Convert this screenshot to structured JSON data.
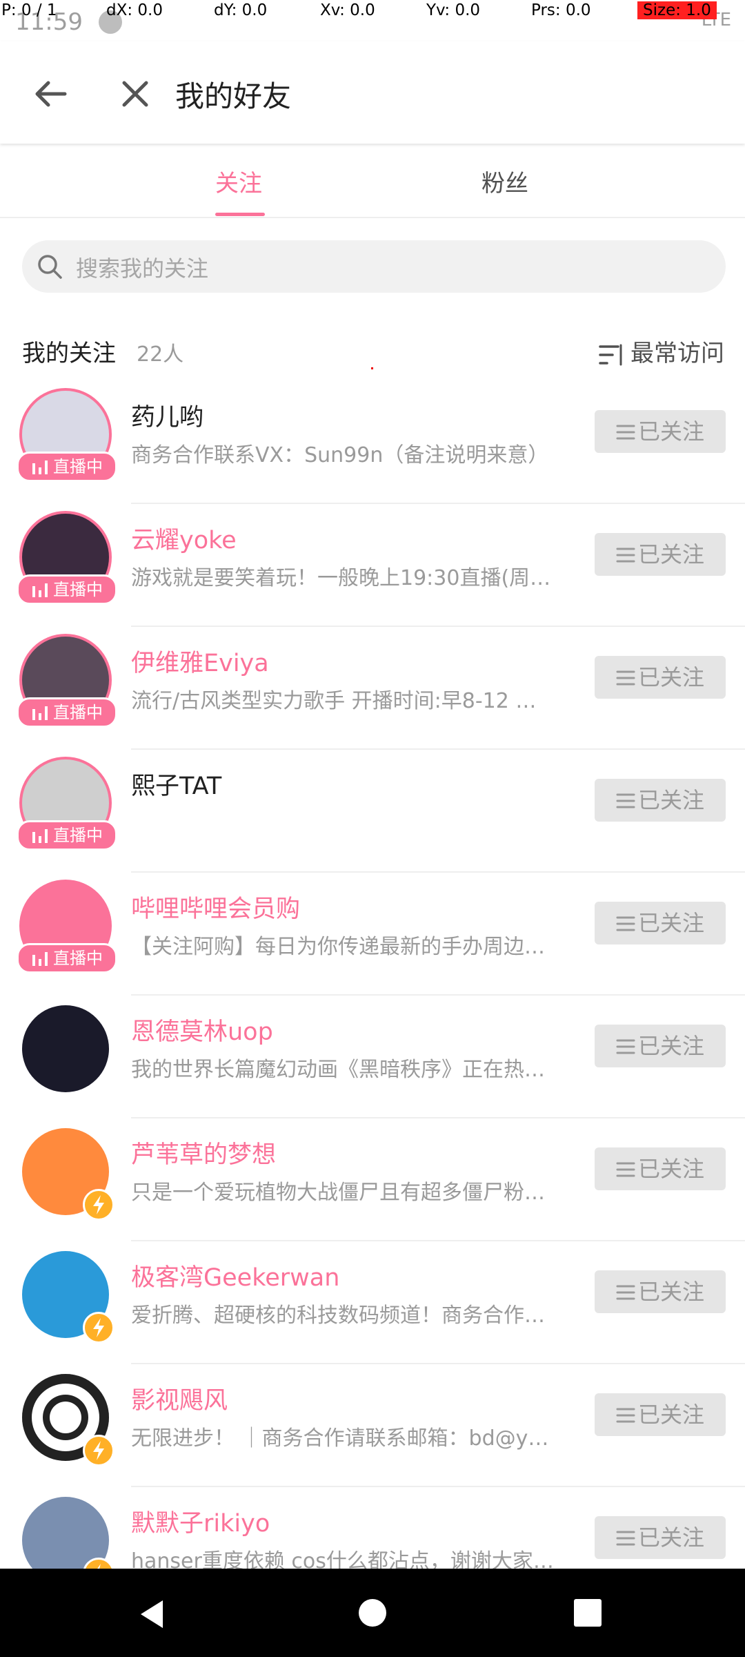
{
  "debug": {
    "p": "P: 0 / 1",
    "dx": "dX: 0.0",
    "dy": "dY: 0.0",
    "xv": "Xv: 0.0",
    "yv": "Yv: 0.0",
    "prs": "Prs: 0.0",
    "size": "Size: 1.0"
  },
  "status": {
    "time": "11:59",
    "right": "LTE"
  },
  "toolbar": {
    "title": "我的好友"
  },
  "tabs": [
    {
      "label": "关注",
      "active": true
    },
    {
      "label": "粉丝",
      "active": false
    }
  ],
  "search": {
    "placeholder": "搜索我的关注"
  },
  "section": {
    "title": "我的关注",
    "count": "22人",
    "sort_label": "最常访问"
  },
  "live_label": "直播中",
  "follow_label": "已关注",
  "users": [
    {
      "name": "药儿哟",
      "desc": "商务合作联系VX：Sun99n（备注说明来意）",
      "name_color": "dark",
      "badge": "live",
      "avatar_color": "#d9d9e6"
    },
    {
      "name": "云耀yoke",
      "desc": "游戏就是要笑着玩！一般晚上19:30直播(周…",
      "name_color": "pink",
      "badge": "live",
      "avatar_color": "#3b2a3f"
    },
    {
      "name": "伊维雅Eviya",
      "desc": "流行/古风类型实力歌手 开播时间:早8-12 …",
      "name_color": "pink",
      "badge": "live",
      "avatar_color": "#5a4a5a"
    },
    {
      "name": "熙子TAT",
      "desc": "",
      "name_color": "dark",
      "badge": "live",
      "avatar_color": "#cfcfcf"
    },
    {
      "name": "哔哩哔哩会员购",
      "desc": "【关注阿购】每日为你传递最新的手办周边…",
      "name_color": "pink",
      "badge": "live",
      "avatar_color": "#fb7299"
    },
    {
      "name": "恩德莫林uop",
      "desc": "我的世界长篇魔幻动画《黑暗秩序》正在热…",
      "name_color": "pink",
      "badge": "none",
      "avatar_color": "#1a1a2a"
    },
    {
      "name": "芦苇草的梦想",
      "desc": "只是一个爱玩植物大战僵尸且有超多僵尸粉…",
      "name_color": "pink",
      "badge": "bolt",
      "avatar_color": "#ff8a3d"
    },
    {
      "name": "极客湾Geekerwan",
      "desc": "爱折腾、超硬核的科技数码频道！商务合作…",
      "name_color": "pink",
      "badge": "bolt",
      "avatar_color": "#2a9ad9"
    },
    {
      "name": "影视飓风",
      "desc": "无限进步！ ｜商务合作请联系邮箱：bd@ys…",
      "name_color": "pink",
      "badge": "bolt",
      "avatar_color": "#ffffff"
    },
    {
      "name": "默默子rikiyo",
      "desc": "hanser重度依赖 cos什么都沾点，谢谢大家…",
      "name_color": "pink",
      "badge": "bolt",
      "avatar_color": "#7a8fb0"
    }
  ],
  "colors": {
    "accent": "#fb7299",
    "button_bg": "#e5e5e5",
    "bolt": "#ffb027"
  }
}
